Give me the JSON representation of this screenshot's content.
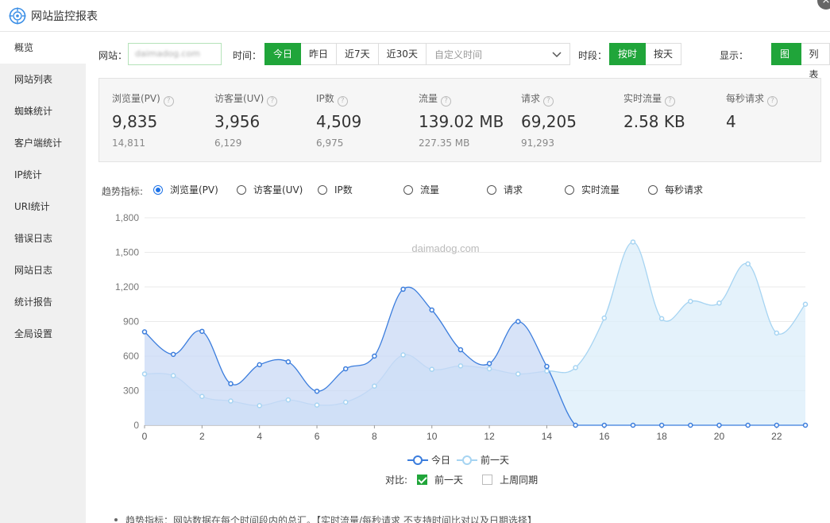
{
  "app": {
    "title": "网站监控报表",
    "close_glyph": "×"
  },
  "sidebar": {
    "items": [
      {
        "label": "概览",
        "active": true
      },
      {
        "label": "网站列表"
      },
      {
        "label": "蜘蛛统计"
      },
      {
        "label": "客户端统计"
      },
      {
        "label": "IP统计"
      },
      {
        "label": "URI统计"
      },
      {
        "label": "错误日志"
      },
      {
        "label": "网站日志"
      },
      {
        "label": "统计报告"
      },
      {
        "label": "全局设置"
      }
    ]
  },
  "toolbar": {
    "site_label": "网站：",
    "site_value": "daimadog.com",
    "time_label": "时间：",
    "time_buttons": [
      "今日",
      "昨日",
      "近7天",
      "近30天"
    ],
    "custom_time_placeholder": "自定义时间",
    "period_label": "时段：",
    "period_buttons": [
      "按时",
      "按天"
    ],
    "display_label": "显示：",
    "display_buttons": [
      "图表",
      "列表"
    ]
  },
  "stats": [
    {
      "name": "浏览量(PV)",
      "value": "9,835",
      "prev": "14,811"
    },
    {
      "name": "访客量(UV)",
      "value": "3,956",
      "prev": "6,129"
    },
    {
      "name": "IP数",
      "value": "4,509",
      "prev": "6,975"
    },
    {
      "name": "流量",
      "value": "139.02 MB",
      "prev": "227.35 MB"
    },
    {
      "name": "请求",
      "value": "69,205",
      "prev": "91,293"
    },
    {
      "name": "实时流量",
      "value": "2.58 KB",
      "prev": ""
    },
    {
      "name": "每秒请求",
      "value": "4",
      "prev": ""
    }
  ],
  "trend": {
    "label": "趋势指标:",
    "options": [
      "浏览量(PV)",
      "访客量(UV)",
      "IP数",
      "流量",
      "请求",
      "实时流量",
      "每秒请求"
    ],
    "selected_index": 0
  },
  "chart_data": {
    "type": "area",
    "watermark": "daimadog.com",
    "x": [
      0,
      1,
      2,
      3,
      4,
      5,
      6,
      7,
      8,
      9,
      10,
      11,
      12,
      13,
      14,
      15,
      16,
      17,
      18,
      19,
      20,
      21,
      22,
      23
    ],
    "x_ticks": [
      0,
      2,
      4,
      6,
      8,
      10,
      12,
      14,
      16,
      18,
      20,
      22
    ],
    "y_ticks": [
      0,
      300,
      600,
      900,
      1200,
      1500,
      1800
    ],
    "y_tick_labels": [
      "0",
      "300",
      "600",
      "900",
      "1,200",
      "1,500",
      "1,800"
    ],
    "ylim": [
      0,
      1800
    ],
    "xlim": [
      0,
      23
    ],
    "grid": true,
    "series": [
      {
        "name": "今日",
        "color": "#3b7ddd",
        "fill": "#c9daf5",
        "values": [
          810,
          615,
          815,
          360,
          525,
          550,
          295,
          490,
          600,
          1180,
          1000,
          655,
          535,
          900,
          510,
          0,
          0,
          0,
          0,
          0,
          0,
          0,
          0,
          0
        ]
      },
      {
        "name": "前一天",
        "color": "#a6d4f2",
        "fill": "#dbeefa",
        "values": [
          445,
          430,
          250,
          210,
          170,
          220,
          175,
          200,
          340,
          610,
          485,
          515,
          490,
          445,
          470,
          500,
          930,
          1590,
          925,
          1075,
          1060,
          1400,
          800,
          1050
        ]
      }
    ]
  },
  "compare": {
    "label": "对比:",
    "options": [
      {
        "label": "前一天",
        "checked": true
      },
      {
        "label": "上周同期",
        "checked": false
      }
    ]
  },
  "note": "趋势指标：网站数据在每个时间段内的总汇。【实时流量/每秒请求 不支持时间比对以及日期选择】",
  "colors": {
    "accent": "#20a53a",
    "series_today": "#3b7ddd",
    "series_prev": "#a6d4f2"
  }
}
